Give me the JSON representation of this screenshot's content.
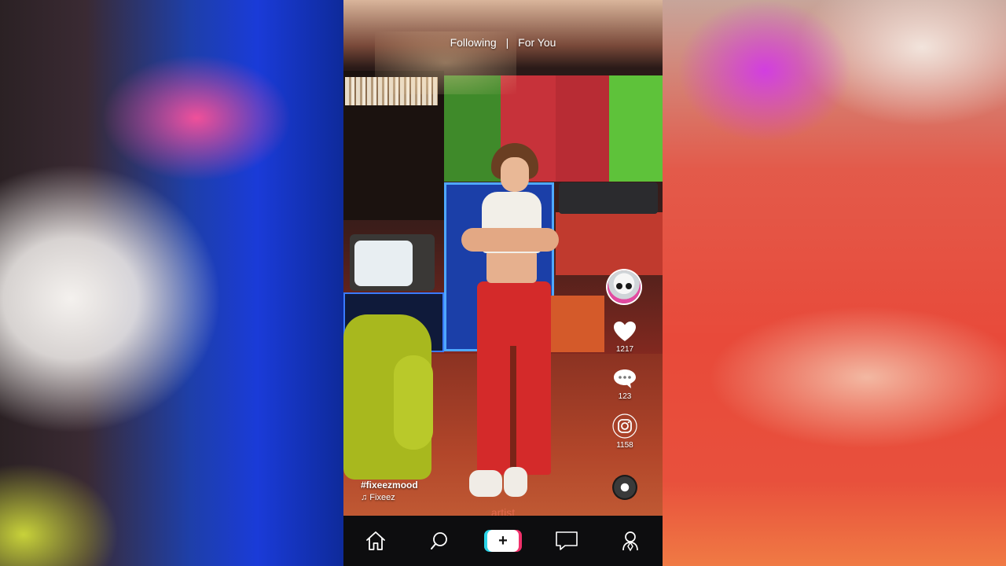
{
  "feed": {
    "tabs": [
      "Following",
      "For You"
    ],
    "separator": "|"
  },
  "video": {
    "hashtag": "#fixeezmood",
    "sound": "♫ Fixeez",
    "overlay_text": "artist"
  },
  "actions": {
    "likes": "1217",
    "comments": "123",
    "shares": "1158"
  },
  "nav": {
    "items": [
      "home-icon",
      "search-icon",
      "add-button",
      "inbox-icon",
      "profile-icon"
    ]
  },
  "colors": {
    "accent_cyan": "#2bd4e8",
    "accent_pink": "#f0306a",
    "nav_bg": "#0d0d0f"
  }
}
